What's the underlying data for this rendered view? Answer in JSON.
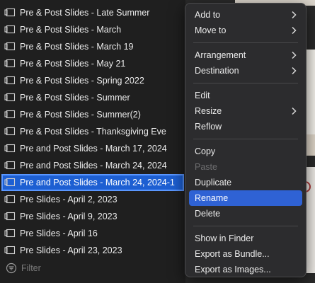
{
  "sidebar": {
    "items": [
      {
        "label": "Pre & Post Slides - Late Summer",
        "selected": false
      },
      {
        "label": "Pre & Post Slides - March",
        "selected": false
      },
      {
        "label": "Pre & Post Slides - March 19",
        "selected": false
      },
      {
        "label": "Pre & Post Slides - May 21",
        "selected": false
      },
      {
        "label": "Pre & Post Slides - Spring 2022",
        "selected": false
      },
      {
        "label": "Pre & Post Slides - Summer",
        "selected": false
      },
      {
        "label": "Pre & Post Slides - Summer(2)",
        "selected": false
      },
      {
        "label": "Pre & Post Slides - Thanksgiving Eve",
        "selected": false
      },
      {
        "label": "Pre and Post Slides - March 17, 2024",
        "selected": false
      },
      {
        "label": "Pre and Post Slides - March 24, 2024",
        "selected": false
      },
      {
        "label": "Pre and Post Slides - March 24, 2024-1",
        "selected": true
      },
      {
        "label": "Pre Slides - April 2, 2023",
        "selected": false
      },
      {
        "label": "Pre Slides - April 9, 2023",
        "selected": false
      },
      {
        "label": "Pre Slides - April 16",
        "selected": false
      },
      {
        "label": "Pre Slides - April 23, 2023",
        "selected": false
      }
    ],
    "item_icon": "presentation-icon",
    "filter": {
      "placeholder": "Filter",
      "icon": "filter-icon"
    }
  },
  "context_menu": {
    "groups": [
      [
        {
          "label": "Add to",
          "submenu": true,
          "disabled": false
        },
        {
          "label": "Move to",
          "submenu": true,
          "disabled": false
        }
      ],
      [
        {
          "label": "Arrangement",
          "submenu": true,
          "disabled": false
        },
        {
          "label": "Destination",
          "submenu": true,
          "disabled": false
        }
      ],
      [
        {
          "label": "Edit",
          "submenu": false,
          "disabled": false
        },
        {
          "label": "Resize",
          "submenu": true,
          "disabled": false
        },
        {
          "label": "Reflow",
          "submenu": false,
          "disabled": false
        }
      ],
      [
        {
          "label": "Copy",
          "submenu": false,
          "disabled": false
        },
        {
          "label": "Paste",
          "submenu": false,
          "disabled": true
        },
        {
          "label": "Duplicate",
          "submenu": false,
          "disabled": false
        },
        {
          "label": "Rename",
          "submenu": false,
          "disabled": false,
          "highlighted": true
        },
        {
          "label": "Delete",
          "submenu": false,
          "disabled": false
        }
      ],
      [
        {
          "label": "Show in Finder",
          "submenu": false,
          "disabled": false
        },
        {
          "label": "Export as Bundle...",
          "submenu": false,
          "disabled": false
        },
        {
          "label": "Export as Images...",
          "submenu": false,
          "disabled": false
        }
      ]
    ]
  },
  "colors": {
    "selection": "#1d5fd2",
    "menu_highlight": "#2f62d4",
    "background": "#1e1e1e",
    "menu_background": "#2c2c2e"
  }
}
